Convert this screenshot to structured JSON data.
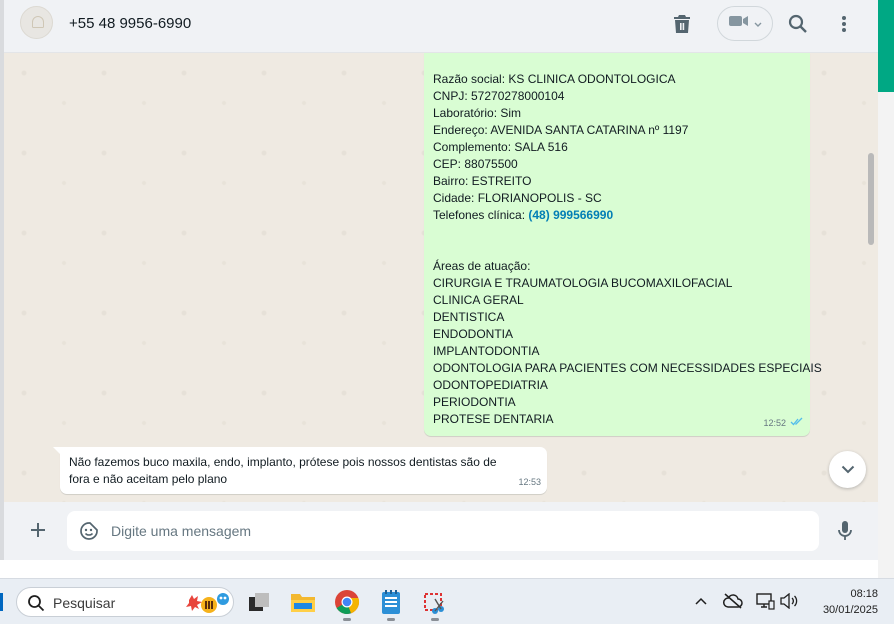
{
  "header": {
    "contact_name": "+55 48 9956-6990"
  },
  "message_out": {
    "lines": [
      "Razão social: KS CLINICA ODONTOLOGICA",
      "CNPJ: 57270278000104",
      "Laboratório: Sim",
      "Endereço: AVENIDA SANTA CATARINA nº 1197",
      "Complemento: SALA 516",
      "CEP: 88075500",
      "Bairro: ESTREITO",
      "Cidade: FLORIANOPOLIS - SC"
    ],
    "phone_label": "Telefones clínica: ",
    "phone_value": "(48) 999566990",
    "areas_title": "Áreas de atuação:",
    "areas": [
      "CIRURGIA E TRAUMATOLOGIA BUCOMAXILOFACIAL",
      "CLINICA GERAL",
      "DENTISTICA",
      "ENDODONTIA",
      "IMPLANTODONTIA",
      "ODONTOLOGIA PARA PACIENTES COM NECESSIDADES ESPECIAIS",
      "ODONTOPEDIATRIA",
      "PERIODONTIA",
      "PROTESE DENTARIA"
    ],
    "time": "12:52",
    "status_icon": "double-check-read-icon"
  },
  "message_in": {
    "line1": "Não fazemos buco maxila, endo, implanto, prótese pois nossos dentistas são de",
    "line2": "fora e não aceitam pelo plano",
    "time": "12:53"
  },
  "composer": {
    "placeholder": "Digite uma mensagem"
  },
  "taskbar": {
    "search_placeholder": "Pesquisar",
    "time": "08:18",
    "date": "30/01/2025"
  },
  "colors": {
    "accent": "#00a884",
    "bubble_out": "#d9fdd3",
    "link": "#027eb5",
    "read_ticks": "#53bdeb"
  }
}
